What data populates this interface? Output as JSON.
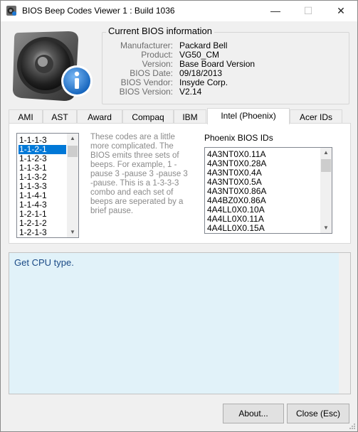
{
  "window": {
    "title": "BIOS Beep Codes Viewer 1 : Build 1036",
    "minimize_glyph": "—",
    "maximize_glyph": "☐",
    "close_glyph": "✕"
  },
  "logo": {
    "icon": "speaker-info-icon"
  },
  "bios_info": {
    "title": "Current BIOS information",
    "rows": [
      {
        "label": "Manufacturer:",
        "value": "Packard Bell"
      },
      {
        "label": "Product:",
        "value": "VG50_CM"
      },
      {
        "label": "Version:",
        "value": "Base Board Version"
      },
      {
        "label": "BIOS Date:",
        "value": "09/18/2013"
      },
      {
        "label": "BIOS Vendor:",
        "value": "Insyde Corp."
      },
      {
        "label": "BIOS Version:",
        "value": "V2.14"
      }
    ]
  },
  "tabs": [
    {
      "label": "AMI"
    },
    {
      "label": "AST"
    },
    {
      "label": "Award"
    },
    {
      "label": "Compaq"
    },
    {
      "label": "IBM"
    },
    {
      "label": "Intel (Phoenix)",
      "active": true
    },
    {
      "label": "Acer IDs"
    }
  ],
  "beep_codes": {
    "items": [
      "1-1-1-3",
      "1-1-2-1",
      "1-1-2-3",
      "1-1-3-1",
      "1-1-3-2",
      "1-1-3-3",
      "1-1-4-1",
      "1-1-4-3",
      "1-2-1-1",
      "1-2-1-2",
      "1-2-1-3"
    ],
    "selected_index": 1
  },
  "description": "These codes are a little more complicated. The BIOS emits three sets of beeps. For example, 1 -pause 3 -pause 3 -pause 3 -pause. This is a 1-3-3-3 combo and each set of beeps are seperated by a brief pause.",
  "phoenix": {
    "label": "Phoenix BIOS IDs",
    "items": [
      "4A3NT0X0.11A",
      "4A3NT0X0.28A",
      "4A3NT0X0.4A",
      "4A3NT0X0.5A",
      "4A3NT0X0.86A",
      "4A4BZ0X0.86A",
      "4A4LL0X0.10A",
      "4A4LL0X0.11A",
      "4A4LL0X0.15A"
    ]
  },
  "output": {
    "text": "Get CPU type."
  },
  "buttons": {
    "about": "About...",
    "close": "Close (Esc)"
  },
  "colors": {
    "selection": "#0078d7",
    "output_bg": "#e1f2f9",
    "output_text": "#1a4a86",
    "info_badge": "#1e7ad6"
  }
}
